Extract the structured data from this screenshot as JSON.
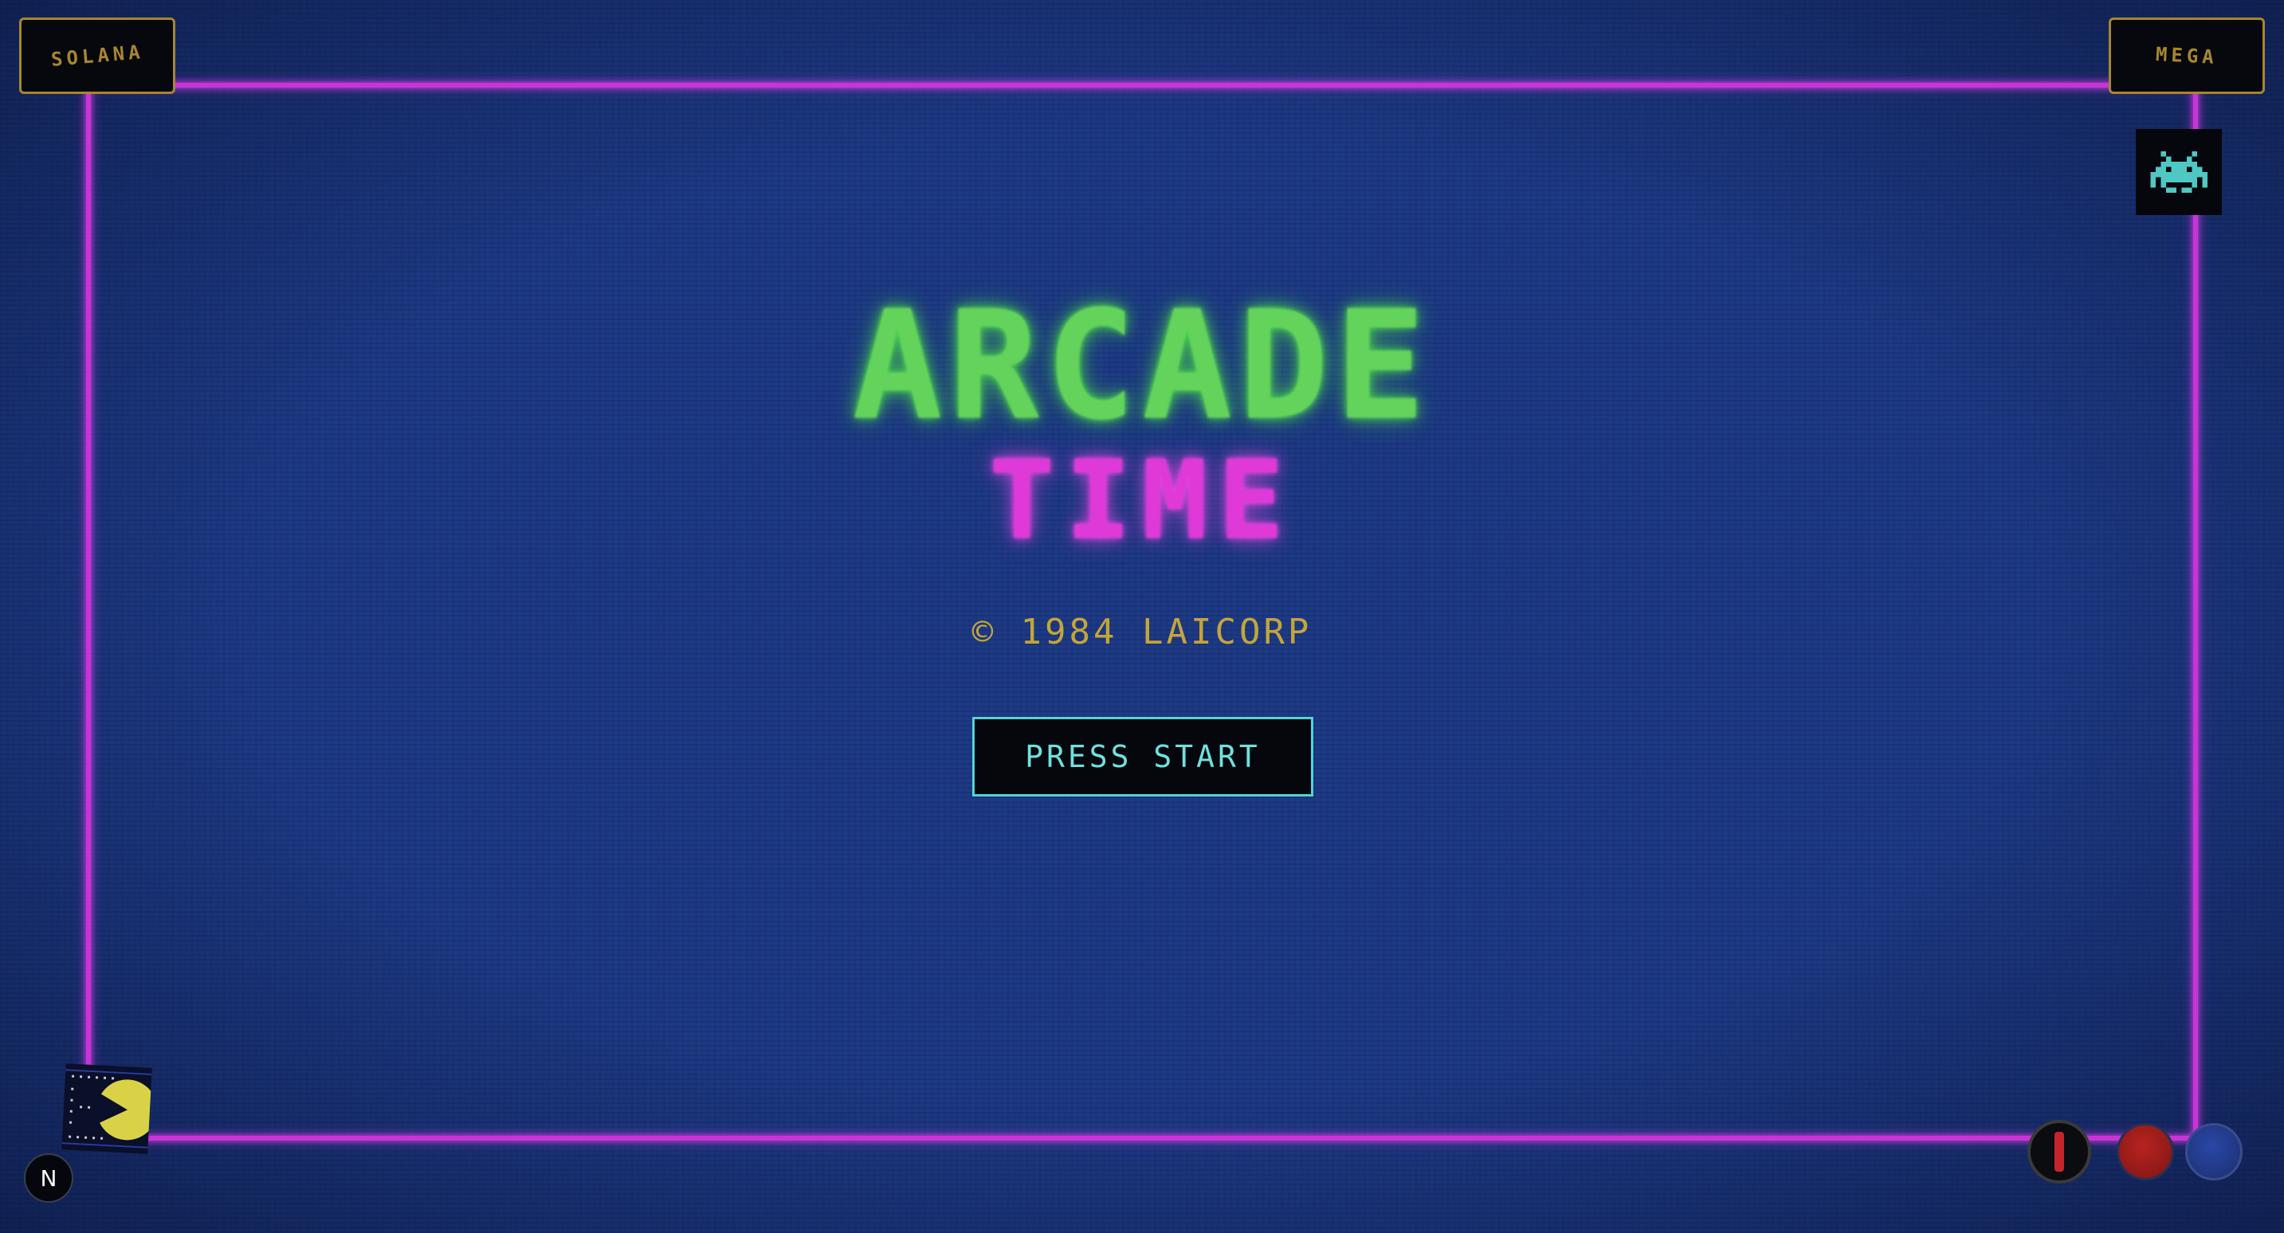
{
  "badges": {
    "left_label": "SOLANA",
    "right_label": "MEGA"
  },
  "title": {
    "main": "ARCADE",
    "sub": "TIME"
  },
  "copyright": "© 1984 LAICORP",
  "start_button": {
    "label": "PRESS START"
  },
  "nav": {
    "logo_letter": "N"
  },
  "colors": {
    "background": "#1d3a86",
    "frame": "#c934d6",
    "title_main": "#63d35c",
    "title_sub": "#df3ad8",
    "copyright": "#c5a53a",
    "badge_border": "#a7862e",
    "start_border": "#4fd6d6",
    "invader": "#4fc8c4",
    "pacman": "#d9d246",
    "button_red": "#b8231f",
    "button_blue": "#2a47a6",
    "joystick_stick": "#c6242a"
  },
  "icons": {
    "top_right_tile": "space-invader-icon",
    "bottom_left_tile": "pacman-icon",
    "bottom_left_round": "n-logo-icon",
    "controls": [
      "joystick-icon",
      "red-arcade-button",
      "blue-arcade-button"
    ]
  }
}
